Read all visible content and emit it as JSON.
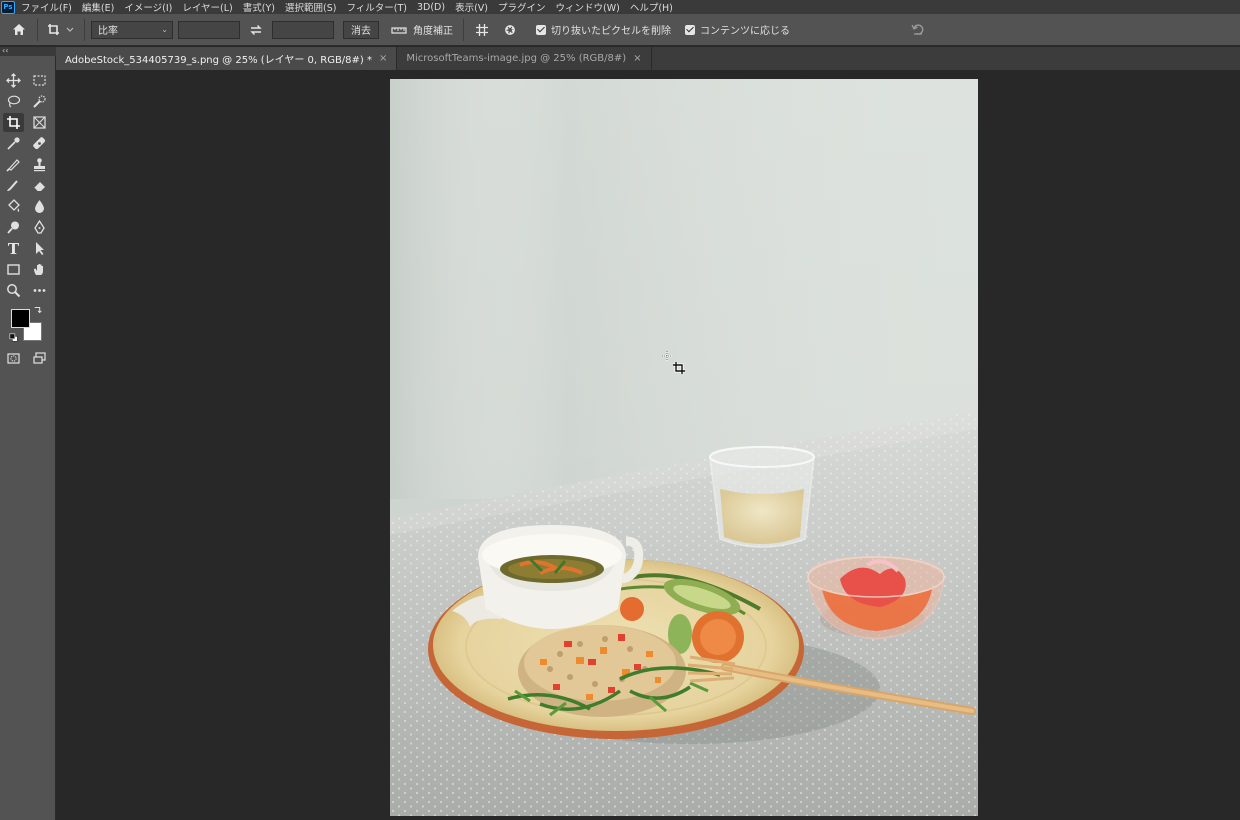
{
  "app": {
    "logo": "Ps"
  },
  "menubar": {
    "items": [
      "ファイル(F)",
      "編集(E)",
      "イメージ(I)",
      "レイヤー(L)",
      "書式(Y)",
      "選択範囲(S)",
      "フィルター(T)",
      "3D(D)",
      "表示(V)",
      "プラグイン",
      "ウィンドウ(W)",
      "ヘルプ(H)"
    ]
  },
  "options": {
    "ratio_select": "比率",
    "width_value": "",
    "height_value": "",
    "clear_label": "消去",
    "straighten_label": "角度補正",
    "delete_cropped_label": "切り抜いたピクセルを削除",
    "delete_cropped_checked": true,
    "content_aware_label": "コンテンツに応じる",
    "content_aware_checked": true
  },
  "panel_collapse_label": "‹‹",
  "tabs": [
    {
      "label": "AdobeStock_534405739_s.png @ 25% (レイヤー 0, RGB/8#) *",
      "active": true
    },
    {
      "label": "MicrosoftTeams-image.jpg @ 25% (RGB/8#)",
      "active": false
    }
  ],
  "tab_close_glyph": "×",
  "tools": {
    "selected": "crop-tool",
    "type_tool_glyph": "T",
    "colors": {
      "foreground": "#000000",
      "background": "#ffffff"
    }
  },
  "document": {
    "image_description_icon": "photo",
    "colors": {
      "wall": "#d5dad6",
      "tablecloth": "#c9ccc9",
      "plate": "#e9d9a6",
      "plate_rim": "#c96a3a"
    }
  }
}
